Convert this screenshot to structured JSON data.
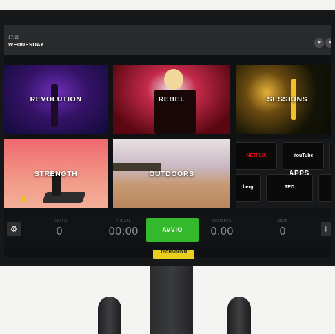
{
  "header": {
    "time": "17:28",
    "day": "WEDNESDAY",
    "buttons": [
      {
        "icon": "chevron-down-icon"
      },
      {
        "icon": "chevron-down-icon"
      }
    ]
  },
  "tiles": {
    "revolution": "REVOLUTION",
    "rebel": "REBEL",
    "sessions": "SESSIONS",
    "strength": "STRENGTH",
    "outdoors": "OUTDOORS",
    "apps": "APPS"
  },
  "apps": [
    "NETFLIX",
    "YouTube",
    "berg",
    "TED"
  ],
  "bottom": {
    "settings_icon": "gear-icon",
    "metrics": [
      {
        "caption": "LIVELLO",
        "value": "0"
      },
      {
        "caption": "DURATA",
        "value": "00:00"
      },
      {
        "caption": "DISTANZA",
        "value": "0.00"
      },
      {
        "caption": "RPM",
        "value": "0"
      }
    ],
    "start_label": "AVVIO",
    "bluetooth_icon": "bluetooth-icon"
  },
  "brand": {
    "logo": "TECHNOGYM",
    "accent": "#34b82c",
    "logo_color": "#e8cf1e"
  }
}
